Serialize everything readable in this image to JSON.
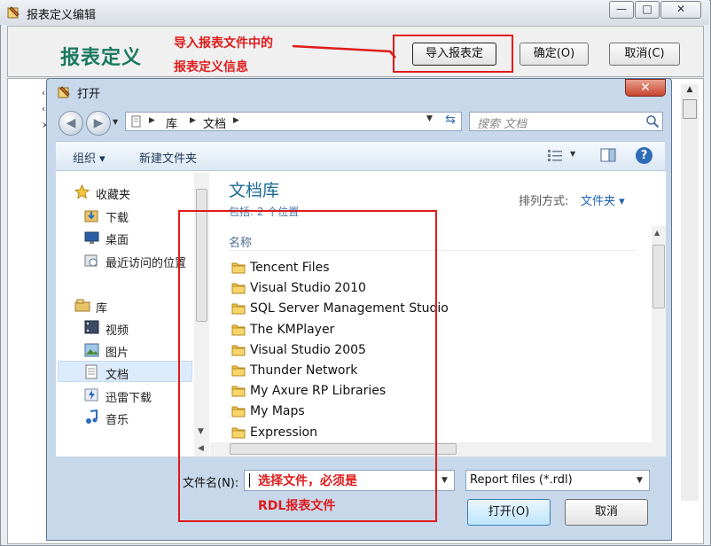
{
  "window": {
    "title": "报表定义编辑",
    "report_label": "报表定义",
    "buttons": {
      "import": "导入报表定",
      "ok": "确定(O)",
      "cancel": "取消(C)"
    },
    "annotation_line1": "导入报表文件中的",
    "annotation_line2": "报表定义信息",
    "controls": {
      "minimize": "—",
      "maximize": "□",
      "close": "✕"
    }
  },
  "dialog": {
    "title": "打开",
    "close": "✕",
    "breadcrumb": [
      "库",
      "文档"
    ],
    "search_placeholder": "搜索 文档",
    "toolbar": {
      "organize": "组织 ▾",
      "new_folder": "新建文件夹",
      "help": "?"
    },
    "nav": {
      "favorites": "收藏夹",
      "favorites_items": [
        "下载",
        "桌面",
        "最近访问的位置"
      ],
      "libraries": "库",
      "library_items": [
        "视频",
        "图片",
        "文档",
        "迅雷下载",
        "音乐"
      ],
      "selected": "文档"
    },
    "library": {
      "title": "文档库",
      "subtitle": "包括: 2 个位置",
      "sort_label": "排列方式:",
      "sort_value": "文件夹 ▾",
      "column": "名称",
      "files": [
        "Tencent Files",
        "Visual Studio 2010",
        "SQL Server Management Studio",
        "The KMPlayer",
        "Visual Studio 2005",
        "Thunder Network",
        "My Axure RP Libraries",
        "My Maps",
        "Expression"
      ]
    },
    "filename_label": "文件名(N):",
    "filename_value": "",
    "filter": "Report files (*.rdl)",
    "buttons": {
      "open": "打开(O)",
      "cancel": "取消"
    },
    "annotation_line1": "选择文件，必须是",
    "annotation_line2": "RDL报表文件"
  },
  "colors": {
    "annotation": "#e01a1a",
    "accent": "#1b7a5e",
    "selection": "#dcebfb"
  }
}
